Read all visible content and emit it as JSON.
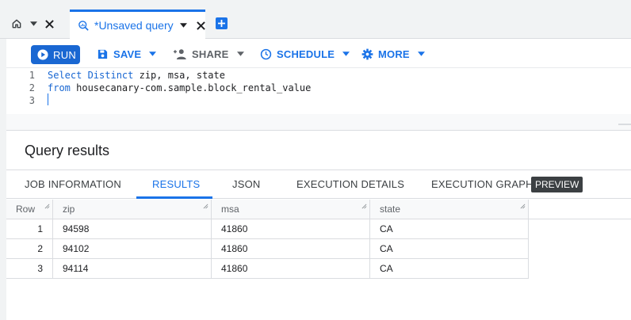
{
  "tabbar": {
    "query_tab_label": "*Unsaved query"
  },
  "toolbar": {
    "run_label": "RUN",
    "save_label": "SAVE",
    "share_label": "SHARE",
    "schedule_label": "SCHEDULE",
    "more_label": "MORE"
  },
  "editor": {
    "lines": [
      {
        "no": "1",
        "kw": "Select Distinct",
        "rest": " zip, msa, state"
      },
      {
        "no": "2",
        "kw": "from",
        "rest": " housecanary-com.sample.block_rental_value"
      },
      {
        "no": "3",
        "kw": "",
        "rest": ""
      }
    ]
  },
  "results": {
    "title": "Query results",
    "tabs": [
      {
        "label": "JOB INFORMATION"
      },
      {
        "label": "RESULTS"
      },
      {
        "label": "JSON"
      },
      {
        "label": "EXECUTION DETAILS"
      },
      {
        "label": "EXECUTION GRAPH"
      }
    ],
    "preview_badge": "PREVIEW",
    "active_tab": "RESULTS",
    "table": {
      "headers": [
        "Row",
        "zip",
        "msa",
        "state"
      ],
      "rows": [
        [
          "1",
          "94598",
          "41860",
          "CA"
        ],
        [
          "2",
          "94102",
          "41860",
          "CA"
        ],
        [
          "3",
          "94114",
          "41860",
          "CA"
        ]
      ]
    }
  },
  "colors": {
    "accent": "#1a73e8",
    "run_button": "#1967d2",
    "badge": "#3c4043"
  },
  "icons": [
    "home-icon",
    "chevron-down-icon",
    "close-icon",
    "query-icon",
    "add-tab-icon",
    "play-icon",
    "save-icon",
    "person-add-icon",
    "schedule-clock-icon",
    "gear-icon",
    "column-resize-icon"
  ]
}
